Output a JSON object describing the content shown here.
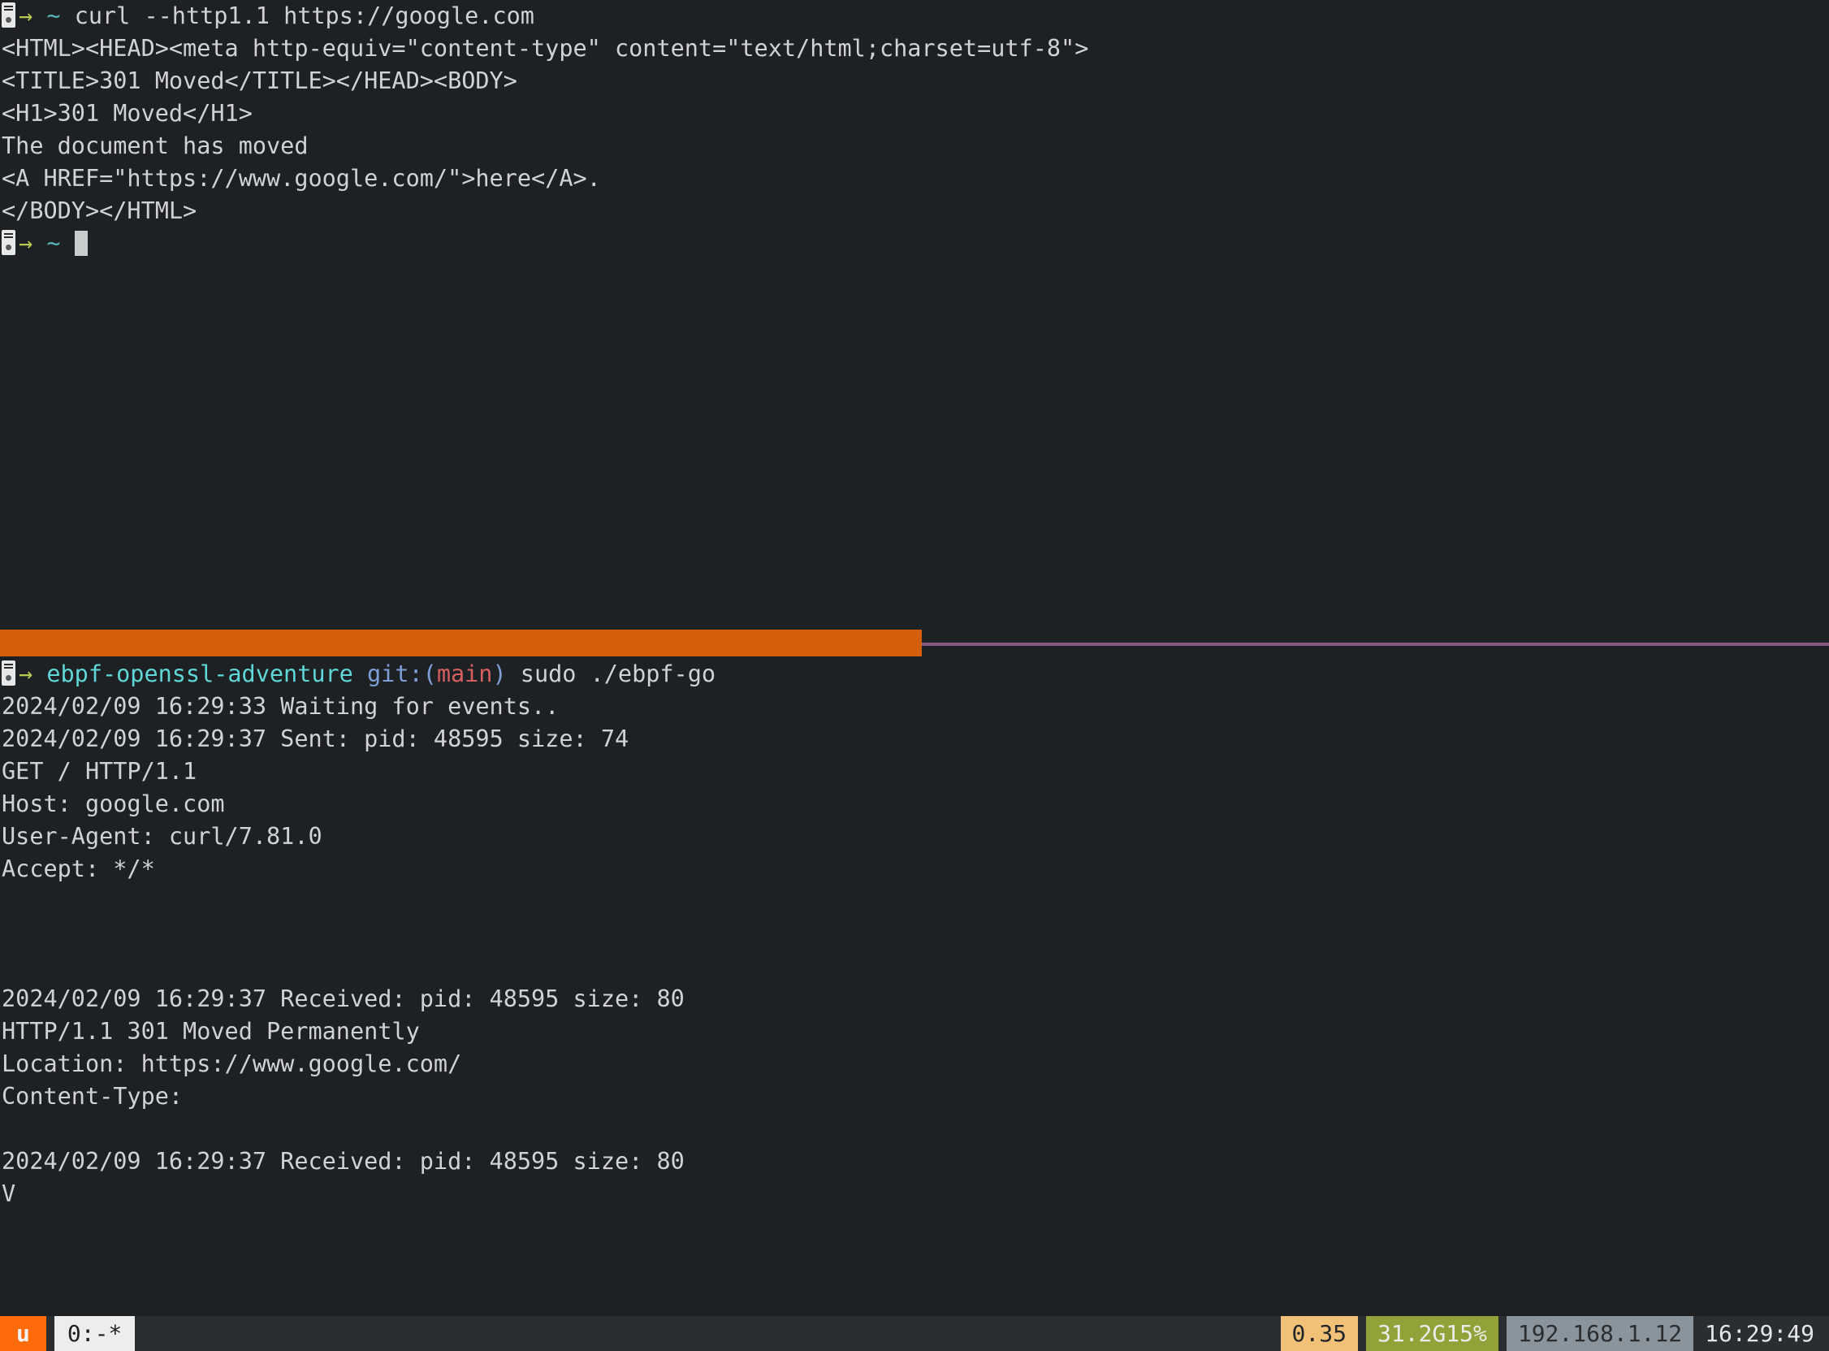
{
  "theme": {
    "background": "#1e2124",
    "foreground": "#d0d3d4",
    "accent_orange": "#d35f0a",
    "accent_purple": "#8a5a82",
    "prompt_arrow": "#b5cc51",
    "prompt_path": "#59b3ba",
    "repo_cyan": "#5fd7d7",
    "git_blue": "#7f9fd8",
    "branch_red": "#d75f5f",
    "cursor": "#c9cccd"
  },
  "top_pane": {
    "prompt": {
      "host_icon": "server-icon",
      "arrow": "→",
      "path": "~",
      "command": "curl --http1.1 https://google.com"
    },
    "output_lines": [
      "<HTML><HEAD><meta http-equiv=\"content-type\" content=\"text/html;charset=utf-8\">",
      "<TITLE>301 Moved</TITLE></HEAD><BODY>",
      "<H1>301 Moved</H1>",
      "The document has moved",
      "<A HREF=\"https://www.google.com/\">here</A>.",
      "</BODY></HTML>"
    ],
    "idle_prompt": {
      "host_icon": "server-icon",
      "arrow": "→",
      "path": "~",
      "cursor": "block"
    }
  },
  "bottom_pane": {
    "prompt": {
      "host_icon": "server-icon",
      "arrow": "→",
      "repo": "ebpf-openssl-adventure",
      "git_prefix": "git:(",
      "git_branch": "main",
      "git_suffix": ")",
      "command": "sudo ./ebpf-go"
    },
    "output_lines": [
      "2024/02/09 16:29:33 Waiting for events..",
      "2024/02/09 16:29:37 Sent: pid: 48595 size: 74",
      "GET / HTTP/1.1",
      "Host: google.com",
      "User-Agent: curl/7.81.0",
      "Accept: */*",
      "",
      "",
      "",
      "2024/02/09 16:29:37 Received: pid: 48595 size: 80",
      "HTTP/1.1 301 Moved Permanently",
      "Location: https://www.google.com/",
      "Content-Type:",
      "",
      "2024/02/09 16:29:37 Received: pid: 48595 size: 80",
      "V"
    ]
  },
  "status_bar": {
    "session": "u",
    "window": "0:-*",
    "load": "0.35",
    "memory": "31.2G15%",
    "ip_address": "192.168.1.12",
    "clock": "16:29:49"
  }
}
